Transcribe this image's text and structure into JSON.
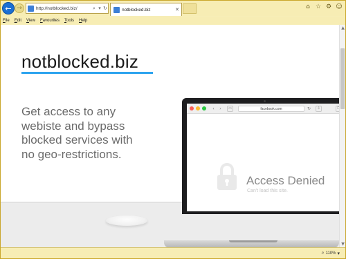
{
  "browser": {
    "address": {
      "url": "http://notblocked.biz/"
    },
    "tab": {
      "title": "notblocked.biz"
    },
    "menu": [
      "File",
      "Edit",
      "View",
      "Favourites",
      "Tools",
      "Help"
    ],
    "icons": [
      "back-arrow-icon",
      "forward-arrow-icon",
      "search-icon",
      "refresh-icon",
      "close-icon",
      "home-icon",
      "star-icon",
      "gear-icon",
      "smiley-icon"
    ],
    "zoom_label": "110%"
  },
  "page": {
    "logo": "notblocked.biz",
    "tagline": [
      "Get access to any",
      "webiste and bypass",
      "blocked services with",
      "no geo-restrictions."
    ],
    "accent": "#2da4ef"
  },
  "laptop_screen": {
    "url": "facebook.com",
    "title": "Access Denied",
    "subtitle": "Can't load this site."
  }
}
